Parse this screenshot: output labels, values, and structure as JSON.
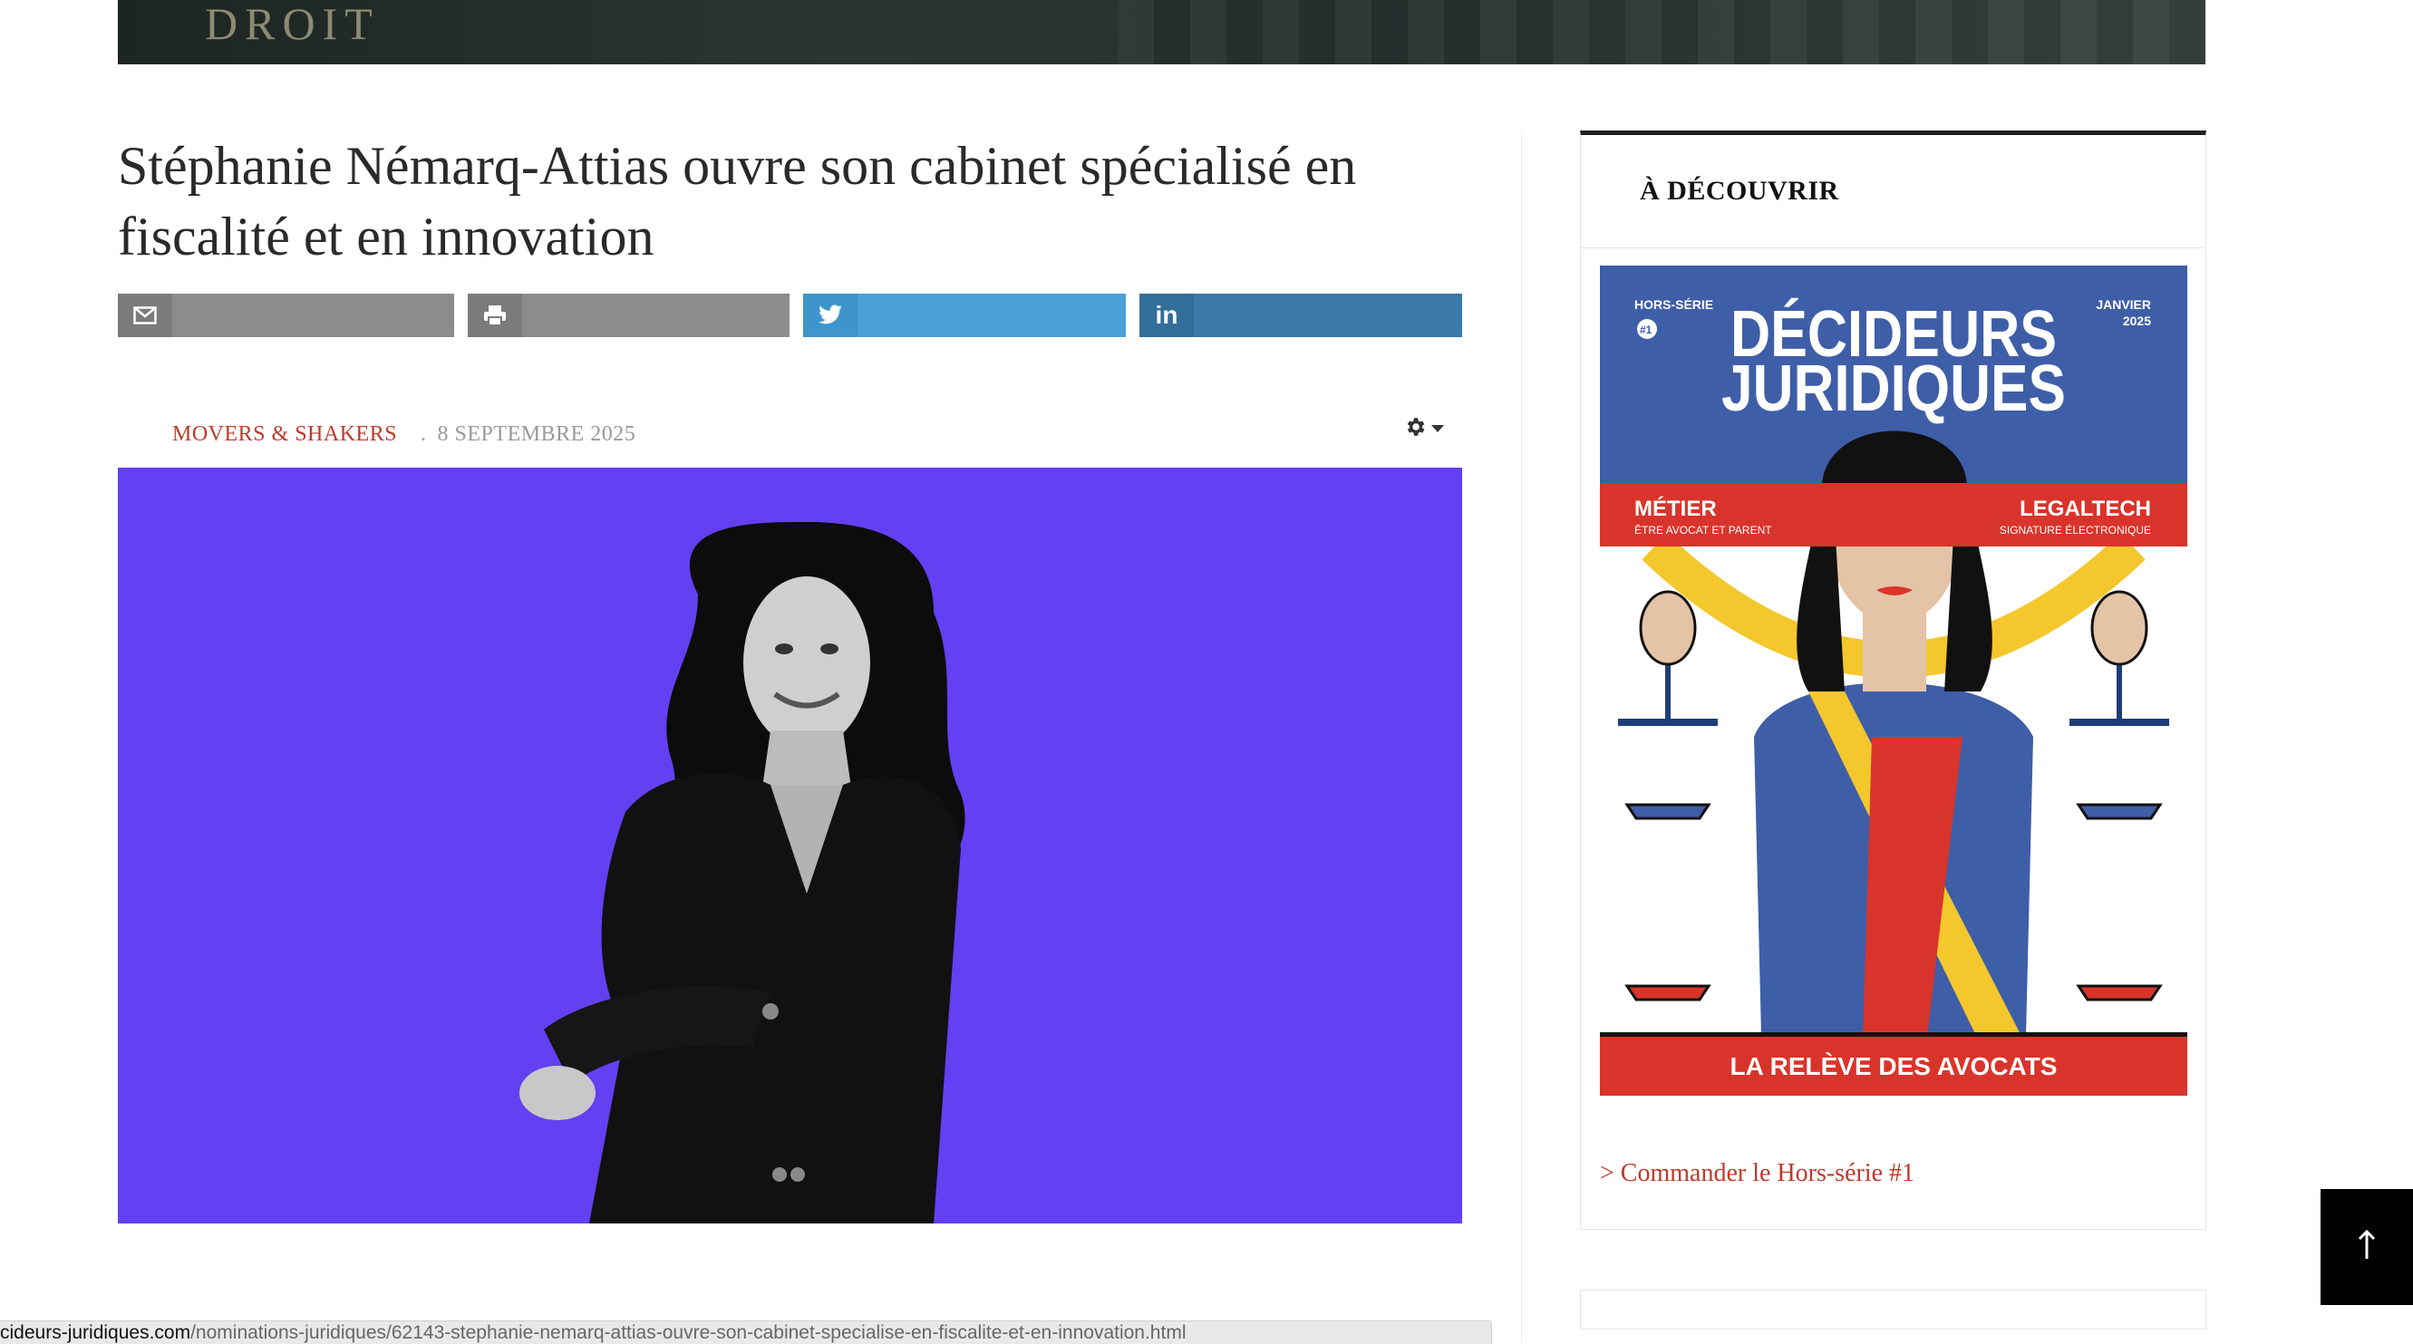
{
  "banner": {
    "word": "DROIT"
  },
  "article": {
    "title": "Stéphanie Némarq-Attias ouvre son cabinet spécialisé en fiscalité et en innovation",
    "category": "MOVERS & SHAKERS",
    "separator": ".",
    "date": "8 SEPTEMBRE 2025"
  },
  "share": {
    "icons": [
      "mail-icon",
      "print-icon",
      "twitter-icon",
      "linkedin-icon"
    ],
    "linkedin_glyph": "in"
  },
  "sidebar": {
    "title": "À DÉCOUVRIR",
    "order_link": "> Commander le Hors-série #1",
    "magazine": {
      "series_line1": "HORS-SÉRIE",
      "series_num": "#1",
      "month": "JANVIER",
      "year": "2025",
      "name_line1": "DÉCIDEURS",
      "name_line2": "JURIDIQUES",
      "left_topic": "MÉTIER",
      "left_sub": "ÊTRE AVOCAT ET PARENT",
      "right_topic": "LEGALTECH",
      "right_sub": "SIGNATURE ÉLECTRONIQUE",
      "footer": "LA RELÈVE DES AVOCATS"
    }
  },
  "statusbar": {
    "host": "cideurs-juridiques.com",
    "path": "/nominations-juridiques/62143-stephanie-nemarq-attias-ouvre-son-cabinet-specialise-en-fiscalite-et-en-innovation.html"
  },
  "colors": {
    "hero_bg": "#6340f2",
    "accent_red": "#c0392b",
    "cover_blue": "#3f5ea8",
    "cover_red": "#d9342b"
  }
}
